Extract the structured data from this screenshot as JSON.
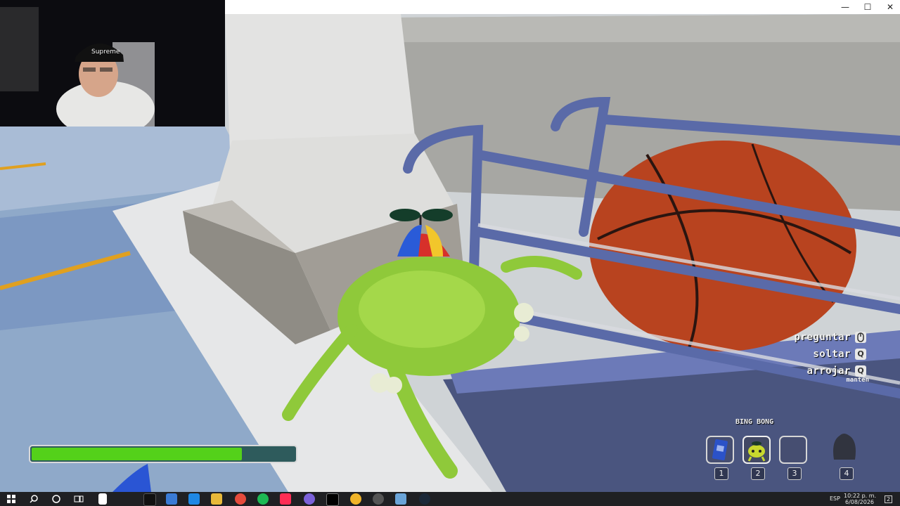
{
  "window": {
    "minimize": "—",
    "maximize": "☐",
    "close": "✕"
  },
  "prompts": [
    {
      "label": "preguntar",
      "key": "mouse-icon"
    },
    {
      "label": "soltar",
      "key": "Q"
    },
    {
      "label": "arrojar",
      "key": "Q",
      "hint": "mantén"
    }
  ],
  "health": {
    "fraction": 0.8
  },
  "inventory": {
    "selected_item_name": "BING BONG",
    "slots": [
      {
        "number": "1",
        "icon": "passport-book-icon"
      },
      {
        "number": "2",
        "icon": "bing-bong-frog-icon",
        "selected": true
      },
      {
        "number": "3",
        "icon": ""
      },
      {
        "number": "4",
        "icon": "backpack-silhouette-icon"
      }
    ]
  },
  "taskbar": {
    "lang": "ESP",
    "time": "10:22 p. m.",
    "date": "6/08/2026",
    "notif_count": "2"
  },
  "colors": {
    "health_fill": "#54d11a",
    "health_bg": "#2e5b5c",
    "frog": "#8fc93a",
    "basketball": "#b8431f",
    "rail": "#5a6aa8"
  }
}
